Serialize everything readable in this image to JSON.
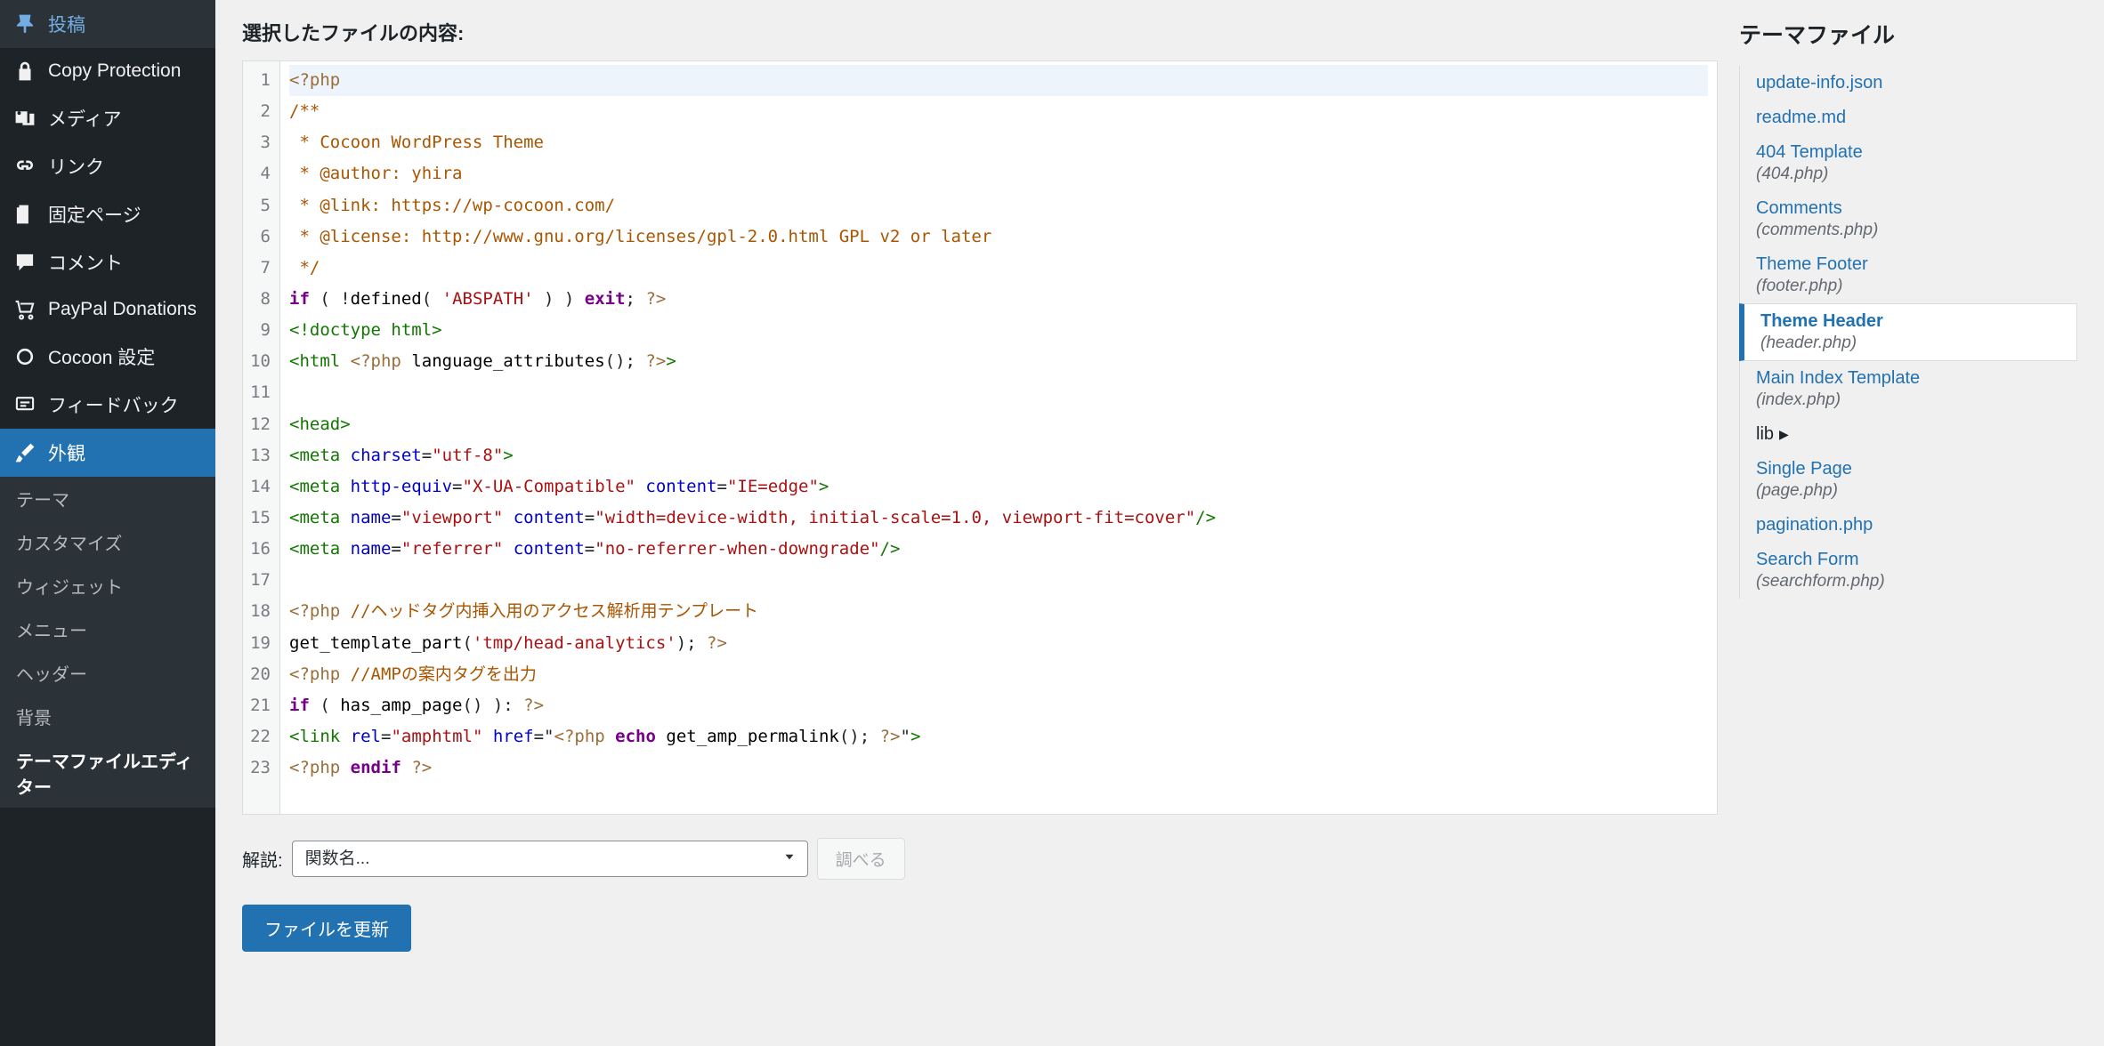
{
  "sidebar": {
    "items": [
      {
        "id": "posts",
        "label": "投稿",
        "icon": "pin"
      },
      {
        "id": "copy-protection",
        "label": "Copy Protection",
        "icon": "lock"
      },
      {
        "id": "media",
        "label": "メディア",
        "icon": "media"
      },
      {
        "id": "links",
        "label": "リンク",
        "icon": "link"
      },
      {
        "id": "pages",
        "label": "固定ページ",
        "icon": "pages"
      },
      {
        "id": "comments",
        "label": "コメント",
        "icon": "comment"
      },
      {
        "id": "paypal",
        "label": "PayPal Donations",
        "icon": "cart"
      },
      {
        "id": "cocoon",
        "label": "Cocoon 設定",
        "icon": "circle"
      },
      {
        "id": "feedback",
        "label": "フィードバック",
        "icon": "feedback"
      },
      {
        "id": "appearance",
        "label": "外観",
        "icon": "brush",
        "active": true
      }
    ],
    "submenu": [
      {
        "id": "themes",
        "label": "テーマ"
      },
      {
        "id": "customize",
        "label": "カスタマイズ"
      },
      {
        "id": "widgets",
        "label": "ウィジェット"
      },
      {
        "id": "menus",
        "label": "メニュー"
      },
      {
        "id": "header",
        "label": "ヘッダー"
      },
      {
        "id": "background",
        "label": "背景"
      },
      {
        "id": "theme-editor",
        "label": "テーマファイルエディター",
        "active": true
      }
    ]
  },
  "main": {
    "heading": "選択したファイルの内容:",
    "lookup_label": "解説:",
    "lookup_placeholder": "関数名...",
    "lookup_button": "調べる",
    "update_button": "ファイルを更新"
  },
  "code_lines": [
    [
      {
        "t": "php",
        "v": "<?php"
      }
    ],
    [
      {
        "t": "com",
        "v": "/**"
      }
    ],
    [
      {
        "t": "com",
        "v": " * Cocoon WordPress Theme"
      }
    ],
    [
      {
        "t": "com",
        "v": " * @author: yhira"
      }
    ],
    [
      {
        "t": "com",
        "v": " * @link: https://wp-cocoon.com/"
      }
    ],
    [
      {
        "t": "com",
        "v": " * @license: http://www.gnu.org/licenses/gpl-2.0.html GPL v2 or later"
      }
    ],
    [
      {
        "t": "com",
        "v": " */"
      }
    ],
    [
      {
        "t": "kw",
        "v": "if"
      },
      {
        "t": "pl",
        "v": " ( !"
      },
      {
        "t": "fn",
        "v": "defined"
      },
      {
        "t": "pl",
        "v": "( "
      },
      {
        "t": "str",
        "v": "'ABSPATH'"
      },
      {
        "t": "pl",
        "v": " ) ) "
      },
      {
        "t": "kw",
        "v": "exit"
      },
      {
        "t": "pl",
        "v": "; "
      },
      {
        "t": "php",
        "v": "?>"
      }
    ],
    [
      {
        "t": "tag",
        "v": "<!doctype html>"
      }
    ],
    [
      {
        "t": "tag",
        "v": "<html"
      },
      {
        "t": "pl",
        "v": " "
      },
      {
        "t": "php",
        "v": "<?php"
      },
      {
        "t": "pl",
        "v": " "
      },
      {
        "t": "fn",
        "v": "language_attributes"
      },
      {
        "t": "pl",
        "v": "(); "
      },
      {
        "t": "php",
        "v": "?>"
      },
      {
        "t": "tag",
        "v": ">"
      }
    ],
    [],
    [
      {
        "t": "tag",
        "v": "<head>"
      }
    ],
    [
      {
        "t": "tag",
        "v": "<meta"
      },
      {
        "t": "pl",
        "v": " "
      },
      {
        "t": "attr",
        "v": "charset"
      },
      {
        "t": "pl",
        "v": "="
      },
      {
        "t": "str",
        "v": "\"utf-8\""
      },
      {
        "t": "tag",
        "v": ">"
      }
    ],
    [
      {
        "t": "tag",
        "v": "<meta"
      },
      {
        "t": "pl",
        "v": " "
      },
      {
        "t": "attr",
        "v": "http-equiv"
      },
      {
        "t": "pl",
        "v": "="
      },
      {
        "t": "str",
        "v": "\"X-UA-Compatible\""
      },
      {
        "t": "pl",
        "v": " "
      },
      {
        "t": "attr",
        "v": "content"
      },
      {
        "t": "pl",
        "v": "="
      },
      {
        "t": "str",
        "v": "\"IE=edge\""
      },
      {
        "t": "tag",
        "v": ">"
      }
    ],
    [
      {
        "t": "tag",
        "v": "<meta"
      },
      {
        "t": "pl",
        "v": " "
      },
      {
        "t": "attr",
        "v": "name"
      },
      {
        "t": "pl",
        "v": "="
      },
      {
        "t": "str",
        "v": "\"viewport\""
      },
      {
        "t": "pl",
        "v": " "
      },
      {
        "t": "attr",
        "v": "content"
      },
      {
        "t": "pl",
        "v": "="
      },
      {
        "t": "str",
        "v": "\"width=device-width, initial-scale=1.0, viewport-fit=cover\""
      },
      {
        "t": "tag",
        "v": "/>"
      }
    ],
    [
      {
        "t": "tag",
        "v": "<meta"
      },
      {
        "t": "pl",
        "v": " "
      },
      {
        "t": "attr",
        "v": "name"
      },
      {
        "t": "pl",
        "v": "="
      },
      {
        "t": "str",
        "v": "\"referrer\""
      },
      {
        "t": "pl",
        "v": " "
      },
      {
        "t": "attr",
        "v": "content"
      },
      {
        "t": "pl",
        "v": "="
      },
      {
        "t": "str",
        "v": "\"no-referrer-when-downgrade\""
      },
      {
        "t": "tag",
        "v": "/>"
      }
    ],
    [],
    [
      {
        "t": "php",
        "v": "<?php"
      },
      {
        "t": "pl",
        "v": " "
      },
      {
        "t": "com",
        "v": "//ヘッドタグ内挿入用のアクセス解析用テンプレート"
      }
    ],
    [
      {
        "t": "fn",
        "v": "get_template_part"
      },
      {
        "t": "pl",
        "v": "("
      },
      {
        "t": "str",
        "v": "'tmp/head-analytics'"
      },
      {
        "t": "pl",
        "v": "); "
      },
      {
        "t": "php",
        "v": "?>"
      }
    ],
    [
      {
        "t": "php",
        "v": "<?php"
      },
      {
        "t": "pl",
        "v": " "
      },
      {
        "t": "com",
        "v": "//AMPの案内タグを出力"
      }
    ],
    [
      {
        "t": "kw",
        "v": "if"
      },
      {
        "t": "pl",
        "v": " ( "
      },
      {
        "t": "fn",
        "v": "has_amp_page"
      },
      {
        "t": "pl",
        "v": "() ): "
      },
      {
        "t": "php",
        "v": "?>"
      }
    ],
    [
      {
        "t": "tag",
        "v": "<link"
      },
      {
        "t": "pl",
        "v": " "
      },
      {
        "t": "attr",
        "v": "rel"
      },
      {
        "t": "pl",
        "v": "="
      },
      {
        "t": "str",
        "v": "\"amphtml\""
      },
      {
        "t": "pl",
        "v": " "
      },
      {
        "t": "attr",
        "v": "href"
      },
      {
        "t": "pl",
        "v": "=\""
      },
      {
        "t": "php",
        "v": "<?php"
      },
      {
        "t": "pl",
        "v": " "
      },
      {
        "t": "kw",
        "v": "echo"
      },
      {
        "t": "pl",
        "v": " "
      },
      {
        "t": "fn",
        "v": "get_amp_permalink"
      },
      {
        "t": "pl",
        "v": "(); "
      },
      {
        "t": "php",
        "v": "?>"
      },
      {
        "t": "pl",
        "v": "\""
      },
      {
        "t": "tag",
        "v": ">"
      }
    ],
    [
      {
        "t": "php",
        "v": "<?php"
      },
      {
        "t": "pl",
        "v": " "
      },
      {
        "t": "kw",
        "v": "endif"
      },
      {
        "t": "pl",
        "v": " "
      },
      {
        "t": "php",
        "v": "?>"
      }
    ]
  ],
  "right": {
    "title": "テーマファイル",
    "files": [
      {
        "title": "update-info.json"
      },
      {
        "title": "readme.md"
      },
      {
        "title": "404 Template",
        "sub": "(404.php)"
      },
      {
        "title": "Comments",
        "sub": "(comments.php)"
      },
      {
        "title": "Theme Footer",
        "sub": "(footer.php)"
      },
      {
        "title": "Theme Header",
        "sub": "(header.php)",
        "active": true
      },
      {
        "title": "Main Index Template",
        "sub": "(index.php)"
      },
      {
        "title": "lib",
        "folder": true
      },
      {
        "title": "Single Page",
        "sub": "(page.php)"
      },
      {
        "title": "pagination.php"
      },
      {
        "title": "Search Form",
        "sub": "(searchform.php)"
      }
    ]
  }
}
